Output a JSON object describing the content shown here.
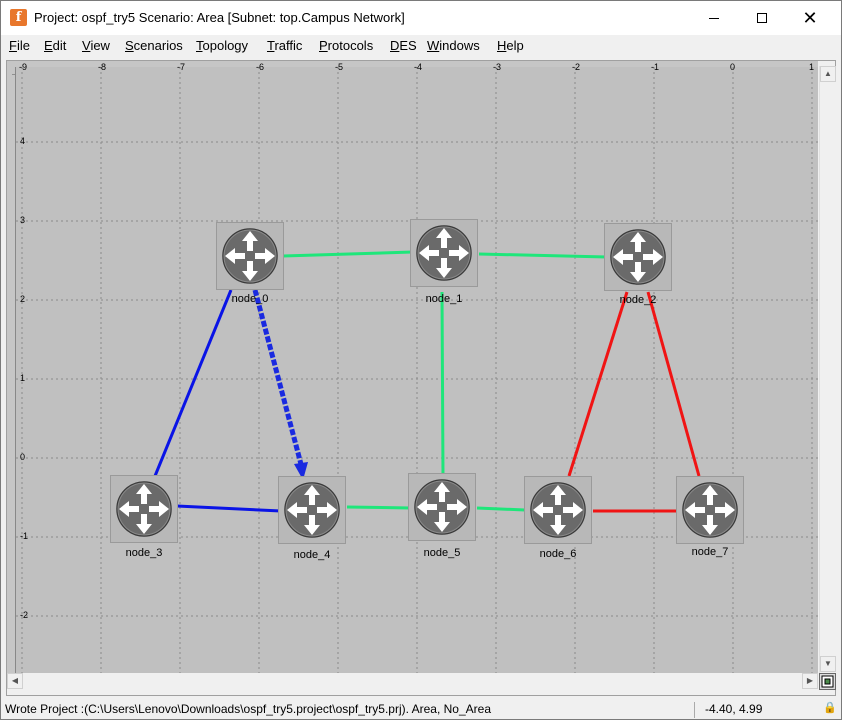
{
  "window": {
    "title": "Project: ospf_try5 Scenario: Area  [Subnet: top.Campus Network]",
    "app_icon_glyph": "f",
    "minimize_icon": "minimize-icon",
    "maximize_icon": "maximize-icon",
    "close_icon": "close-icon",
    "close_glyph": "✕"
  },
  "menu": [
    {
      "u": "F",
      "rest": "ile"
    },
    {
      "u": "E",
      "rest": "dit"
    },
    {
      "u": "V",
      "rest": "iew"
    },
    {
      "u": "S",
      "rest": "cenarios"
    },
    {
      "u": "T",
      "rest": "opology"
    },
    {
      "u": "T",
      "rest": "raffic"
    },
    {
      "u": "P",
      "rest": "rotocols"
    },
    {
      "u": "D",
      "rest": "ES"
    },
    {
      "u": "W",
      "rest": "indows"
    },
    {
      "u": "H",
      "rest": "elp"
    }
  ],
  "ruler": {
    "x_labels": [
      "-9",
      "-8",
      "-7",
      "-6",
      "-5",
      "-4",
      "-3",
      "-2",
      "-1",
      "0",
      "1"
    ],
    "y_labels": [
      "4",
      "3",
      "2",
      "1",
      "0",
      "-1",
      "-2"
    ]
  },
  "nodes": [
    {
      "label": "node_0"
    },
    {
      "label": "node_1"
    },
    {
      "label": "node_2"
    },
    {
      "label": "node_3"
    },
    {
      "label": "node_4"
    },
    {
      "label": "node_5"
    },
    {
      "label": "node_6"
    },
    {
      "label": "node_7"
    }
  ],
  "link_colors": {
    "green": "#1ee67a",
    "blue": "#0a14e6",
    "red": "#f01414",
    "dashed_blue": "#1a2ae0"
  },
  "status": {
    "message": "Wrote Project :(C:\\Users\\Lenovo\\Downloads\\ospf_try5.project\\ospf_try5.prj).  Area, No_Area",
    "coords": "-4.40, 4.99",
    "icon": "lock-icon",
    "icon_glyph": "🔒"
  },
  "scroll_arrows": {
    "up": "▲",
    "down": "▼",
    "left": "◀",
    "right": "▶"
  }
}
